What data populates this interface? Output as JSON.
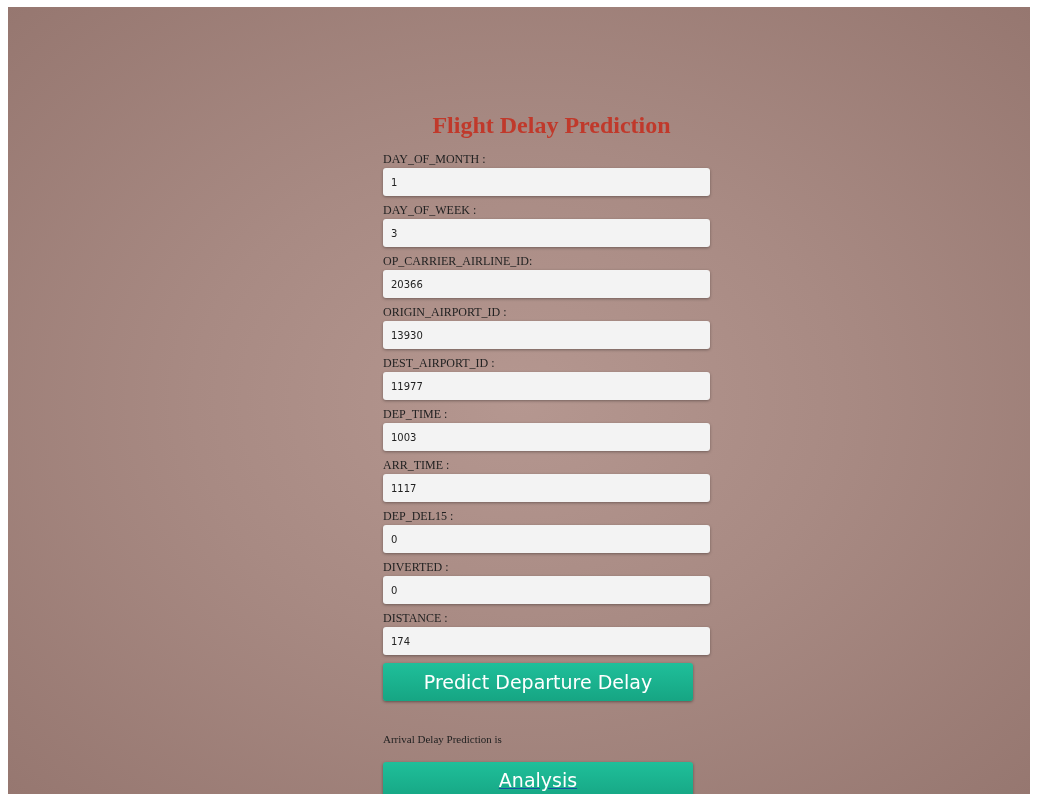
{
  "title": "Flight Delay Prediction",
  "fields": [
    {
      "label": "DAY_OF_MONTH :",
      "value": "1"
    },
    {
      "label": "DAY_OF_WEEK :",
      "value": "3"
    },
    {
      "label": "OP_CARRIER_AIRLINE_ID:",
      "value": "20366"
    },
    {
      "label": "ORIGIN_AIRPORT_ID :",
      "value": "13930"
    },
    {
      "label": "DEST_AIRPORT_ID :",
      "value": "11977"
    },
    {
      "label": "DEP_TIME :",
      "value": "1003"
    },
    {
      "label": "ARR_TIME :",
      "value": "1117"
    },
    {
      "label": "DEP_DEL15 :",
      "value": "0"
    },
    {
      "label": "DIVERTED :",
      "value": "0"
    },
    {
      "label": "DISTANCE :",
      "value": "174"
    }
  ],
  "submit_button": "Predict Departure Delay",
  "result_text": "Arrival Delay Prediction is",
  "analysis_link": "Analysis"
}
